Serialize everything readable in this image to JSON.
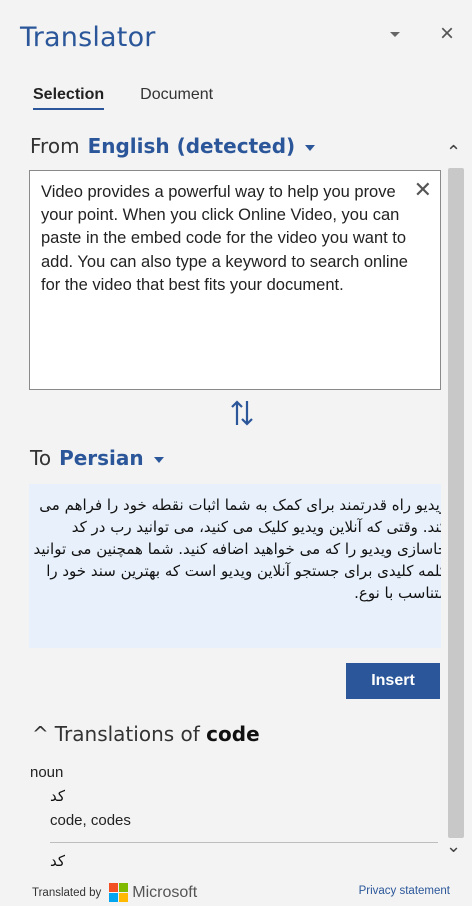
{
  "title": "Translator",
  "tabs": [
    {
      "label": "Selection",
      "active": true
    },
    {
      "label": "Document",
      "active": false
    }
  ],
  "from": {
    "label": "From",
    "language": "English (detected)"
  },
  "source_text": "Video provides a powerful way to help you prove your point. When you click Online Video, you can paste in the embed code for the video you want to add. You can also type a keyword to search online for the video that best fits your document.",
  "to": {
    "label": "To",
    "language": "Persian"
  },
  "target_text": "ویدیو راه قدرتمند برای کمک به شما اثبات نقطه خود را فراهم می کند. وقتی که آنلاین ویدیو کلیک می کنید، می توانید رب در کد جاسازی ویدیو را که می خواهید اضافه کنید. شما همچنین می توانید کلمه کلیدی برای جستجو آنلاین ویدیو است که بهترین سند خود را متناسب با نوع.",
  "insert_label": "Insert",
  "translations": {
    "heading_prefix": "Translations of",
    "term": "code",
    "entries": [
      {
        "pos": "noun",
        "word": "کد",
        "synonyms": "code, codes"
      },
      {
        "word": "کد"
      }
    ]
  },
  "footer": {
    "translated_by": "Translated by",
    "brand": "Microsoft",
    "privacy": "Privacy statement"
  },
  "colors": {
    "accent": "#2b579a",
    "background": "#f3f3f3",
    "target_bg": "#e8f1fb",
    "ms_red": "#f25022",
    "ms_green": "#7fba00",
    "ms_blue": "#00a4ef",
    "ms_yellow": "#ffb900"
  }
}
